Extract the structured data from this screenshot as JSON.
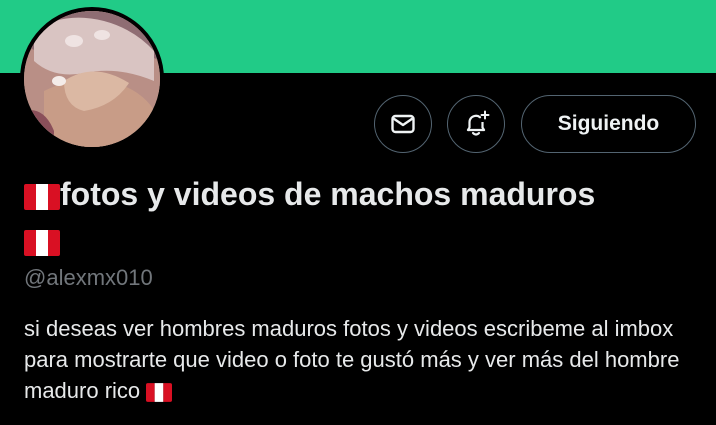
{
  "profile": {
    "display_name": "fotos y videos de machos maduros",
    "handle": "@alexmx010",
    "bio": "si deseas ver hombres maduros fotos y videos escribeme al imbox para mostrarte que video o foto te gustó más y ver más del hombre maduro rico",
    "flag_emoji": "🇵🇪",
    "banner_color": "#21cb87"
  },
  "actions": {
    "message_icon": "mail-icon",
    "notify_icon": "bell-plus-icon",
    "follow_label": "Siguiendo"
  },
  "colors": {
    "background": "#000000",
    "text": "#e7e9ea",
    "secondary_text": "#71767b",
    "button_border": "#536471",
    "flag_red": "#d91023"
  }
}
